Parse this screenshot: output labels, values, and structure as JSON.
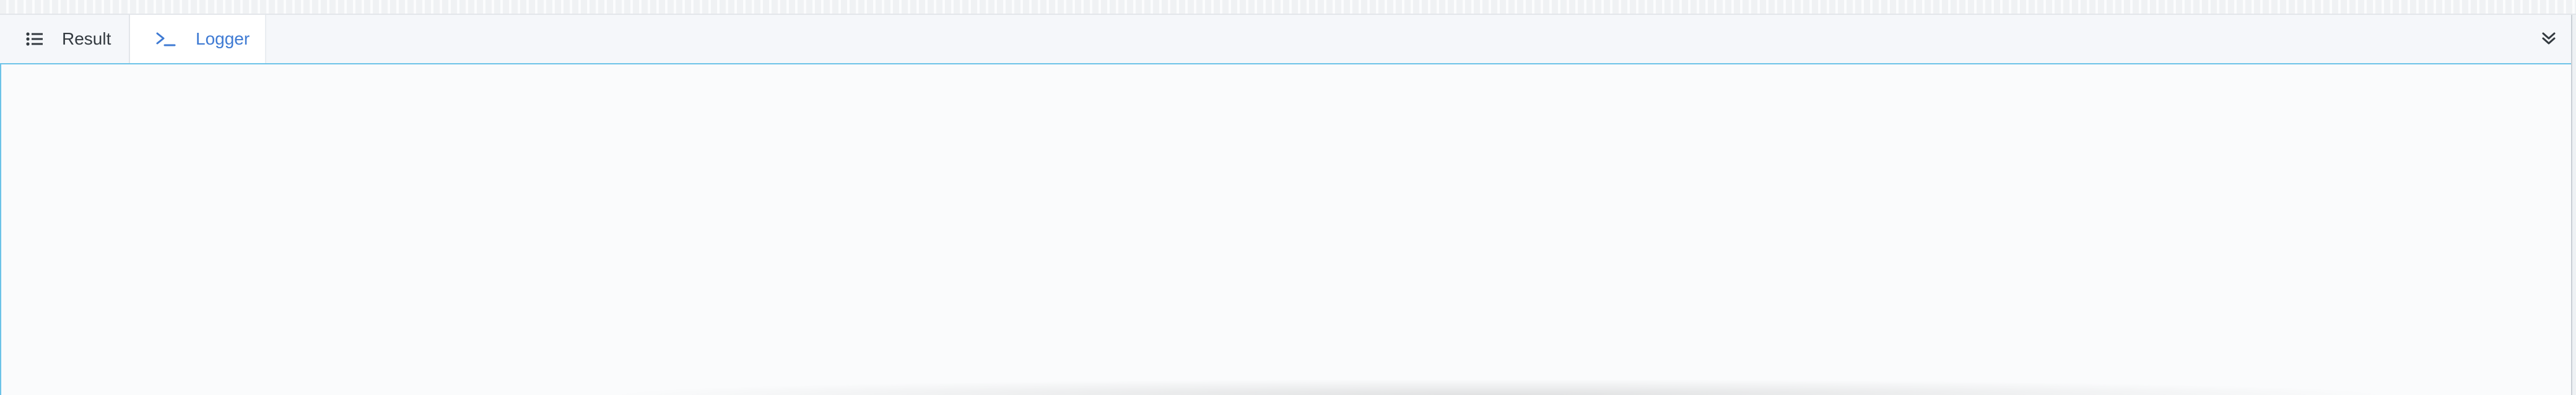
{
  "tabs": [
    {
      "label": "Result",
      "icon": "list-icon",
      "active": false
    },
    {
      "label": "Logger",
      "icon": "terminal-icon",
      "active": true
    }
  ],
  "toolbar": {
    "collapse_icon": "chevrons-down-icon"
  },
  "colors": {
    "accent": "#3e7ad3",
    "active_border": "#6cc3e8",
    "tabbar_bg": "#f5f7fa",
    "panel_bg": "#fafbfc"
  }
}
